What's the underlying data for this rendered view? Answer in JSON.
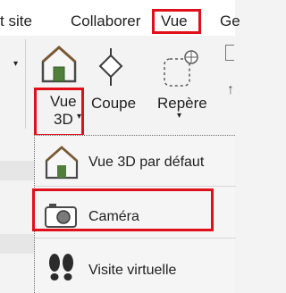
{
  "colors": {
    "highlight": "#e0101a",
    "accent": "#3a6ea5",
    "house_green": "#4f7f3a",
    "house_roof": "#7a5a35"
  },
  "ribbon": {
    "tabs": [
      {
        "label": "t site"
      },
      {
        "label": "Collaborer"
      },
      {
        "label": "Vue",
        "selected": true
      },
      {
        "label": "Ge"
      }
    ]
  },
  "panel": {
    "buttons": {
      "vue3d": {
        "label_line1": "Vue",
        "label_line2": "3D",
        "icon": "house-3d-icon"
      },
      "coupe": {
        "label": "Coupe",
        "icon": "section-icon"
      },
      "repere": {
        "label": "Repère",
        "icon": "callout-icon"
      }
    }
  },
  "menu": {
    "items": [
      {
        "label": "Vue 3D par défaut",
        "icon": "house-3d-icon"
      },
      {
        "label": "Caméra",
        "icon": "camera-icon",
        "highlighted": true
      },
      {
        "label": "Visite virtuelle",
        "icon": "footprints-icon"
      }
    ]
  }
}
